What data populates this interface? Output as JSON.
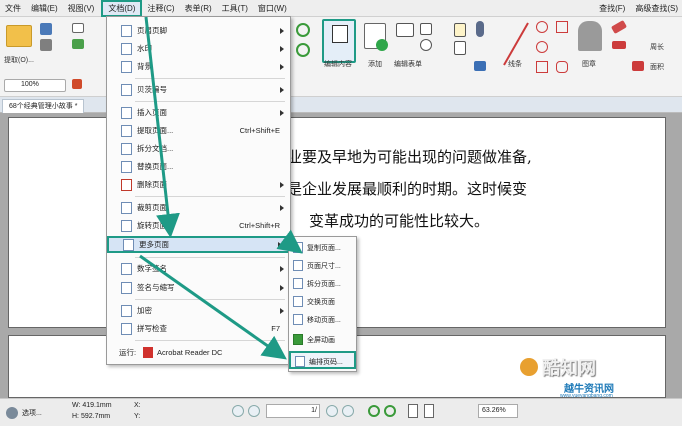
{
  "menubar": {
    "items": [
      "文件",
      "编辑(E)",
      "视图(V)",
      "文档(D)",
      "注释(C)",
      "表单(R)",
      "工具(T)",
      "窗口(W)"
    ],
    "right": [
      "查找(F)",
      "高级查找(S)"
    ]
  },
  "toolbar": {
    "zoom_value": "100%",
    "extract_label": "提取(O)...",
    "edit_content_label": "编辑内容",
    "add_label": "添加",
    "edit_form_label": "编辑表单",
    "line_label": "线条",
    "stamp_label": "图章",
    "perimeter_label": "周长",
    "area_label": "面积"
  },
  "tab": {
    "title": "68个经典管理小故事 *"
  },
  "document": {
    "lines": [
      "业要及早地为可能出现的问题做准备,",
      "是企业发展最顺利的时期。这时候变",
      "变革成功的可能性比较大。"
    ]
  },
  "doc_menu": {
    "items": [
      {
        "label": "页眉页脚",
        "shortcut": "",
        "submenu": true
      },
      {
        "label": "水印",
        "shortcut": "",
        "submenu": true
      },
      {
        "label": "背景",
        "shortcut": "",
        "submenu": true
      },
      {
        "label": "贝茨编号",
        "shortcut": "",
        "submenu": true
      },
      {
        "label": "插入页面",
        "shortcut": "",
        "submenu": true
      },
      {
        "label": "提取页面...",
        "shortcut": "Ctrl+Shift+E",
        "submenu": false
      },
      {
        "label": "拆分文档...",
        "shortcut": "",
        "submenu": false
      },
      {
        "label": "替换页面...",
        "shortcut": "",
        "submenu": false
      },
      {
        "label": "删除页面",
        "shortcut": "",
        "submenu": true
      },
      {
        "label": "裁剪页面",
        "shortcut": "",
        "submenu": true
      },
      {
        "label": "旋转页面...",
        "shortcut": "Ctrl+Shift+R",
        "submenu": false
      },
      {
        "label": "更多页面",
        "shortcut": "",
        "submenu": true
      },
      {
        "label": "数字签名",
        "shortcut": "",
        "submenu": true
      },
      {
        "label": "签名与缩写",
        "shortcut": "",
        "submenu": true
      },
      {
        "label": "加密",
        "shortcut": "",
        "submenu": true
      },
      {
        "label": "拼写检查",
        "shortcut": "F7",
        "submenu": false
      },
      {
        "label": "运行:",
        "shortcut": "",
        "submenu": false
      }
    ],
    "run_app": "Acrobat Reader DC"
  },
  "more_pages_submenu": {
    "items": [
      "复制页面...",
      "页面尺寸...",
      "拆分页面...",
      "交换页面",
      "移动页面...",
      "全屏动画",
      "编排页码..."
    ]
  },
  "statusbar": {
    "select_label": "选项...",
    "width": "W: 419.1mm",
    "height": "H: 592.7mm",
    "x": "X:",
    "y": "Y:",
    "page": "1/",
    "zoom": "63.26%"
  },
  "watermark": {
    "brand": "酷知网",
    "site": "越牛资讯网",
    "url": "www.yueyangbang.com"
  },
  "colors": {
    "highlight_border": "#1e9a86",
    "arrow": "#1e9a86",
    "pdf_red": "#d0312d"
  }
}
